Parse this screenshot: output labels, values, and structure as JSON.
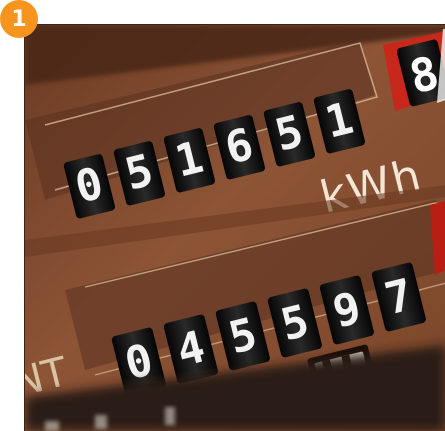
{
  "badge": {
    "number": "1",
    "color": "#f7941e"
  },
  "meter": {
    "unit": "kWh",
    "side_label": "NT",
    "top_counter": {
      "digits": [
        "0",
        "5",
        "1",
        "6",
        "5",
        "1"
      ],
      "red_digit": "8"
    },
    "bottom_counter": {
      "digits": [
        "0",
        "4",
        "5",
        "5",
        "9",
        "7"
      ]
    },
    "colors": {
      "panel": "#8a5234",
      "red_drum": "#d8261c",
      "drum": "#1b1b1b"
    }
  }
}
